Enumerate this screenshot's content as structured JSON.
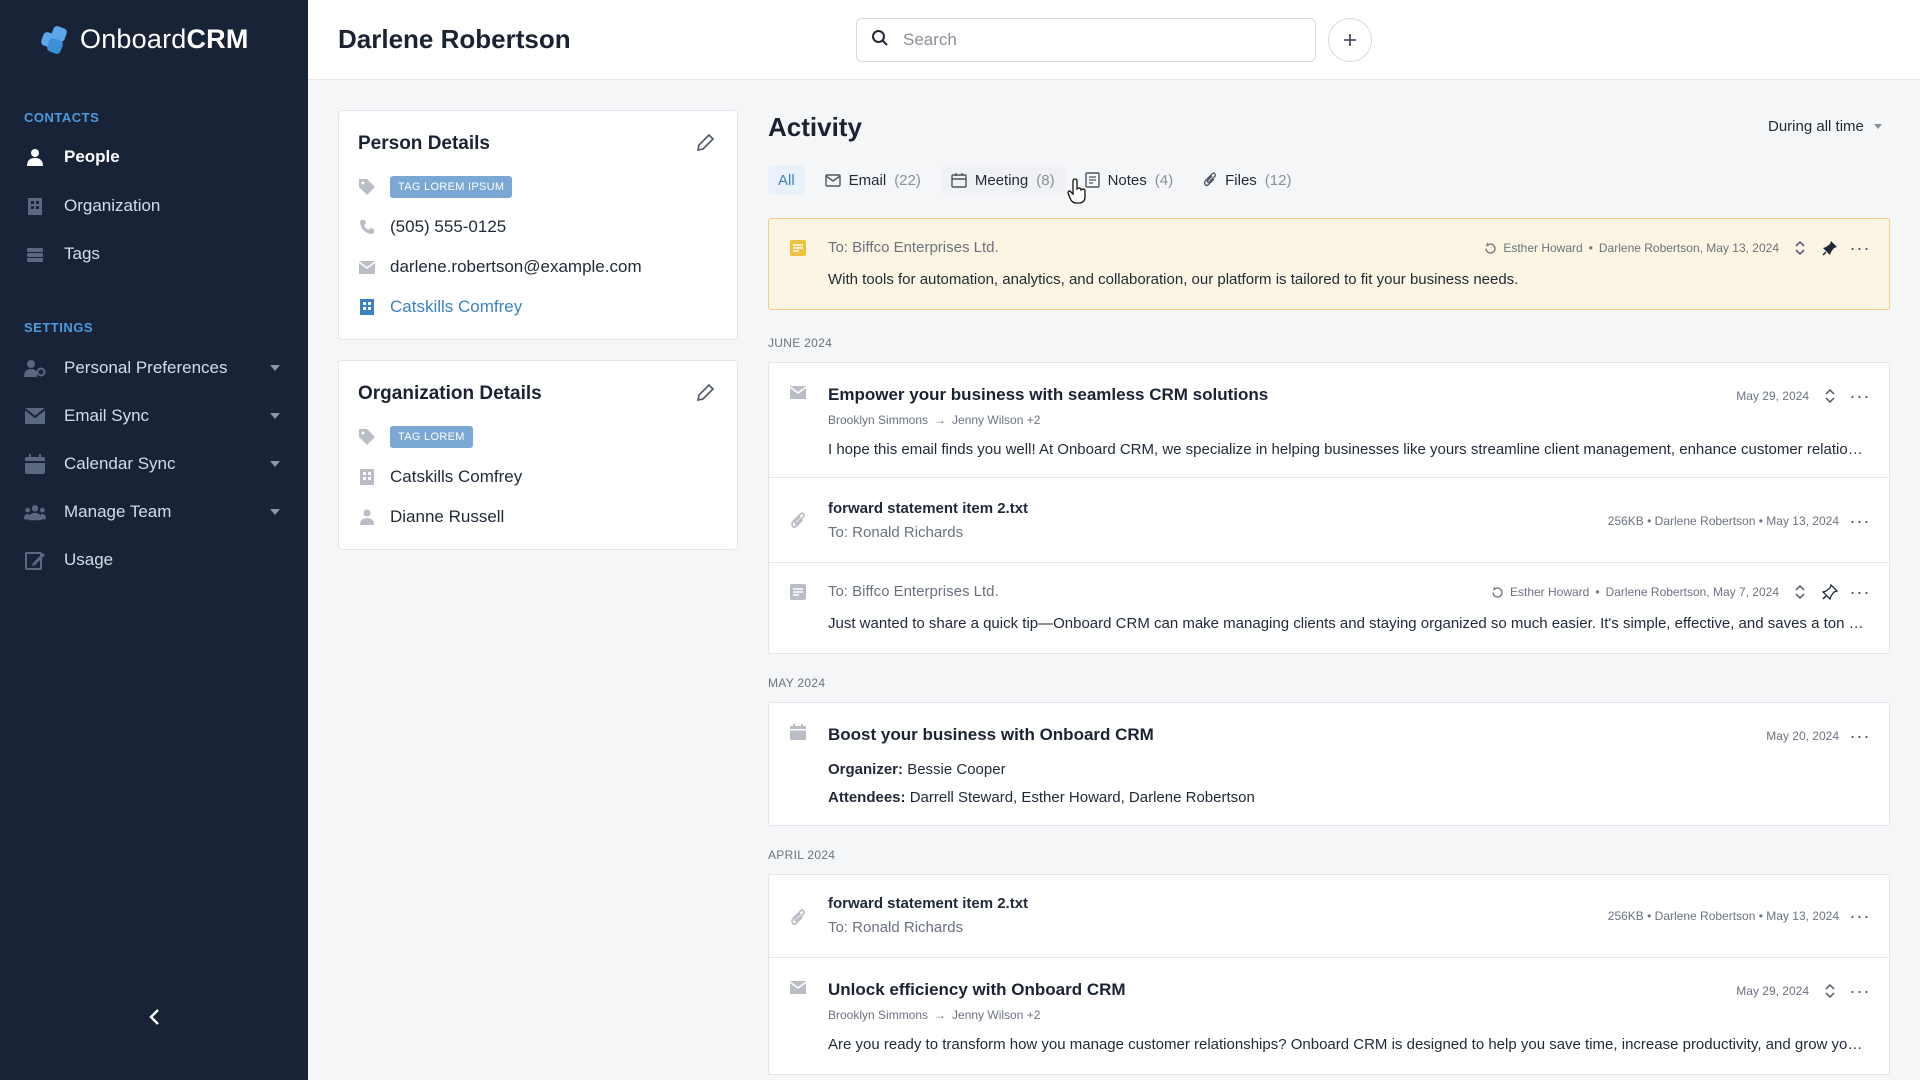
{
  "app": {
    "name_light": "Onboard",
    "name_bold": "CRM"
  },
  "sidebar": {
    "contacts_label": "CONTACTS",
    "contacts": [
      {
        "label": "People",
        "icon": "person-icon",
        "active": true
      },
      {
        "label": "Organization",
        "icon": "building-icon"
      },
      {
        "label": "Tags",
        "icon": "tags-icon"
      }
    ],
    "settings_label": "SETTINGS",
    "settings": [
      {
        "label": "Personal Preferences",
        "icon": "user-settings-icon"
      },
      {
        "label": "Email Sync",
        "icon": "mail-icon"
      },
      {
        "label": "Calendar Sync",
        "icon": "calendar-icon"
      },
      {
        "label": "Manage Team",
        "icon": "team-icon"
      },
      {
        "label": "Usage",
        "icon": "edit-icon"
      }
    ]
  },
  "header": {
    "title": "Darlene Robertson",
    "search_placeholder": "Search"
  },
  "person_details": {
    "title": "Person Details",
    "tag": "TAG LOREM IPSUM",
    "phone": "(505) 555-0125",
    "email": "darlene.robertson@example.com",
    "organization": "Catskills Comfrey"
  },
  "organization_details": {
    "title": "Organization Details",
    "tag": "TAG LOREM",
    "name": "Catskills Comfrey",
    "owner": "Dianne Russell"
  },
  "activity": {
    "title": "Activity",
    "range": "During all time",
    "filters": [
      {
        "label": "All",
        "count": ""
      },
      {
        "label": "Email",
        "count": "(22)"
      },
      {
        "label": "Meeting",
        "count": "(8)"
      },
      {
        "label": "Notes",
        "count": "(4)"
      },
      {
        "label": "Files",
        "count": "(12)"
      }
    ],
    "pinned_note": {
      "to": "To: Biffco Enterprises Ltd.",
      "meta_author": "Esther Howard",
      "meta_rest": "Darlene Robertson, May 13, 2024",
      "body": "With tools for automation, analytics, and collaboration, our platform is tailored to fit your business needs."
    },
    "june_label": "JUNE 2024",
    "email1": {
      "subject": "Empower your business with seamless CRM solutions",
      "from": "Brooklyn Simmons",
      "to": "Jenny Wilson +2",
      "date": "May 29, 2024",
      "body": "I hope this email finds you well! At Onboard CRM, we specialize in helping businesses like yours streamline client management, enhance customer relationships, and drive growth."
    },
    "file1": {
      "name": "forward statement item 2.txt",
      "to": "To: Ronald Richards",
      "meta": "256KB • Darlene Robertson • May 13, 2024"
    },
    "note2": {
      "to": "To: Biffco Enterprises Ltd.",
      "meta_author": "Esther Howard",
      "meta_rest": "Darlene Robertson, May 7, 2024",
      "body": "Just wanted to share a quick tip—Onboard CRM can make managing clients and staying organized so much easier. It's simple, effective, and saves a ton of time. Let me know if you'd like to know more."
    },
    "may_label": "MAY 2024",
    "meeting1": {
      "subject": "Boost your business with Onboard CRM",
      "date": "May 20, 2024",
      "organizer_label": "Organizer:",
      "organizer": "Bessie Cooper",
      "attendees_label": "Attendees:",
      "attendees": "Darrell Steward, Esther Howard, Darlene Robertson"
    },
    "april_label": "APRIL 2024",
    "file2": {
      "name": "forward statement item 2.txt",
      "to": "To: Ronald Richards",
      "meta": "256KB • Darlene Robertson • May 13, 2024"
    },
    "email2": {
      "subject": "Unlock efficiency with Onboard CRM",
      "from": "Brooklyn Simmons",
      "to": "Jenny Wilson +2",
      "date": "May 29, 2024",
      "body": "Are you ready to transform how you manage customer relationships? Onboard CRM is designed to help you save time, increase productivity, and grow your business."
    }
  },
  "colors": {
    "sidebar_bg": "#182338",
    "accent": "#3b82c4",
    "pinned_bg": "#fdf5e3",
    "tag_bg": "#7aa7d3"
  }
}
